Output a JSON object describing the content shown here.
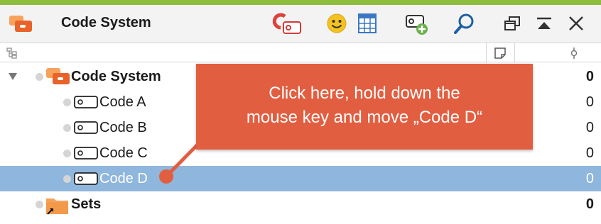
{
  "window": {
    "title": "Code System",
    "accent_color": "#8fbe3e"
  },
  "toolbar": {
    "icons": [
      "code-system-app-icon",
      "code-reset-icon",
      "smiley-icon",
      "table-icon",
      "new-code-icon",
      "search-icon",
      "undock-window-icon",
      "collapse-window-icon",
      "close-icon"
    ]
  },
  "columns": [
    "tree-icon",
    "memo-icon",
    "weight-icon"
  ],
  "tree": {
    "root": {
      "label": "Code System",
      "count": "0"
    },
    "codes": [
      {
        "label": "Code A",
        "count": "0"
      },
      {
        "label": "Code B",
        "count": "0"
      },
      {
        "label": "Code C",
        "count": "0"
      },
      {
        "label": "Code D",
        "count": "0",
        "selected": true
      }
    ],
    "sets": {
      "label": "Sets",
      "count": "0"
    }
  },
  "callout": {
    "line1": "Click here, hold down the",
    "line2": "mouse key and move „Code D“",
    "color": "#e25e40"
  },
  "selection_color": "#8fb6dc"
}
